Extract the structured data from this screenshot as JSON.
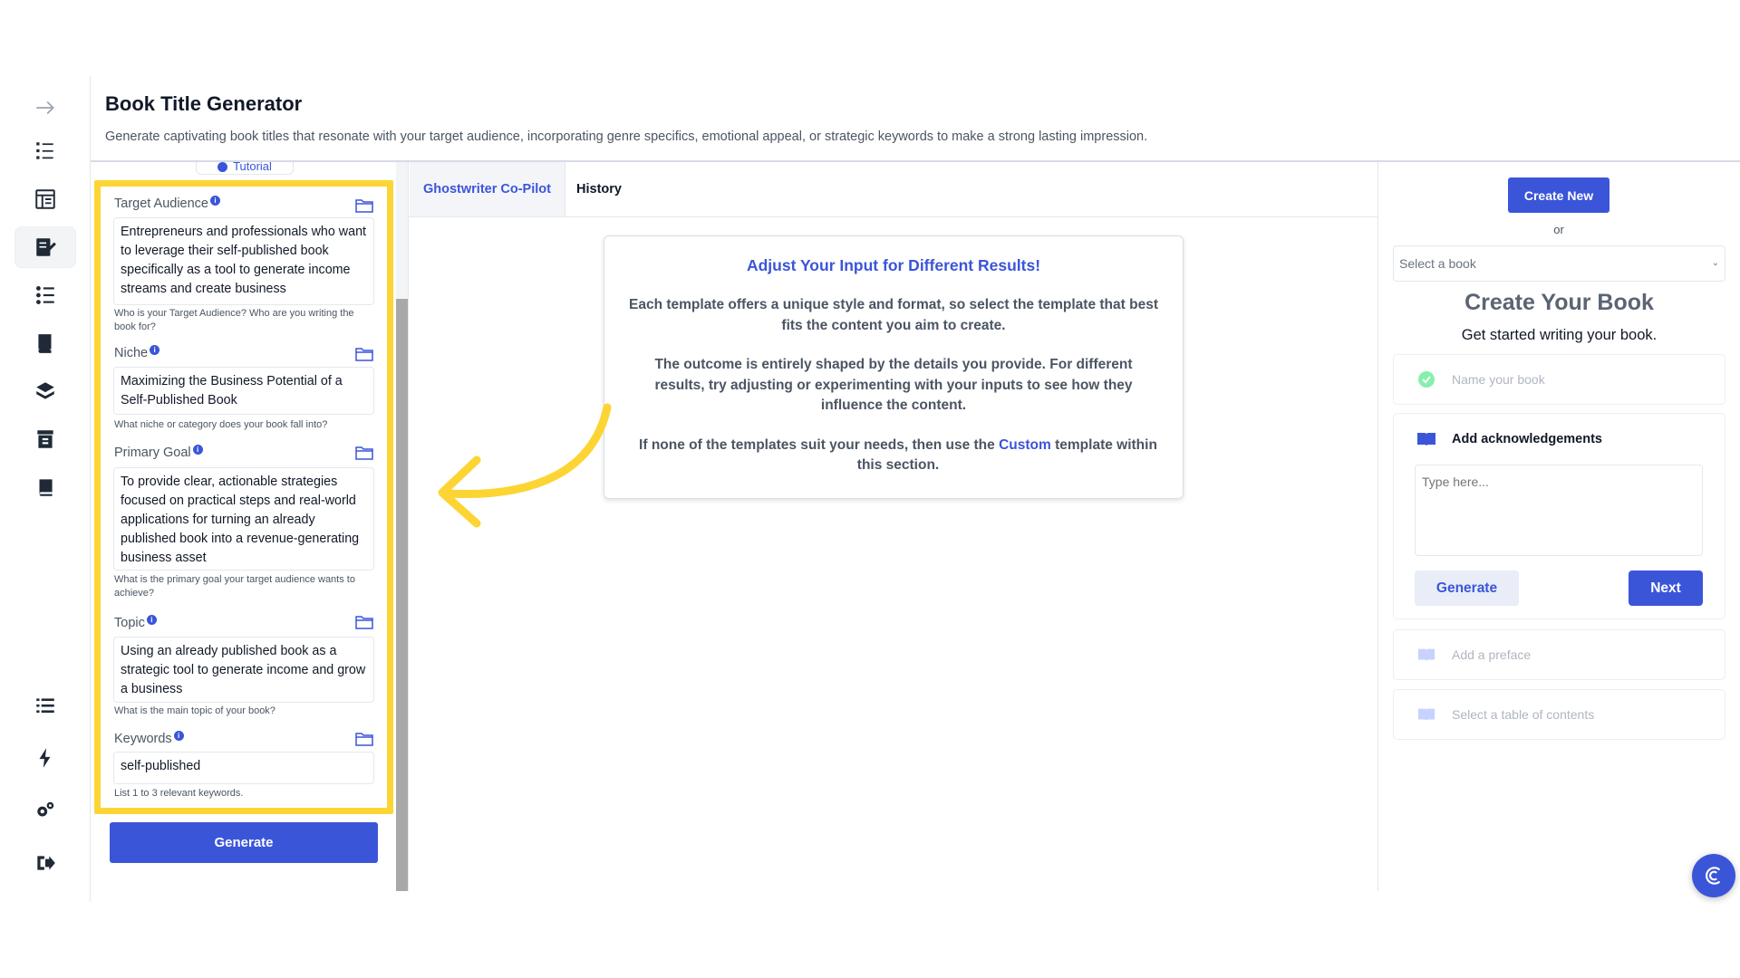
{
  "header": {
    "title": "Book Title Generator",
    "subtitle": "Generate captivating book titles that resonate with your target audience, incorporating genre specifics, emotional appeal, or strategic keywords to make a strong lasting impression."
  },
  "rail": {
    "items": [
      {
        "icon": "arrow-right-icon"
      },
      {
        "icon": "numbered-list-icon"
      },
      {
        "icon": "document-grid-icon"
      },
      {
        "icon": "edit-document-icon",
        "active": true
      },
      {
        "icon": "checklist-icon"
      },
      {
        "icon": "book-stack-icon"
      },
      {
        "icon": "books-icon"
      },
      {
        "icon": "archive-icon"
      },
      {
        "icon": "book-icon"
      },
      {
        "icon": "list-icon"
      },
      {
        "icon": "lightning-icon"
      },
      {
        "icon": "settings-gears-icon"
      },
      {
        "icon": "logout-icon"
      }
    ]
  },
  "form": {
    "tutorial_label": "Tutorial",
    "fields": [
      {
        "label": "Target Audience",
        "value": "Entrepreneurs and professionals who want to leverage their self-published book specifically as a tool to generate income streams and create business",
        "help": "Who is your Target Audience? Who are you writing the book for?"
      },
      {
        "label": "Niche",
        "value": "Maximizing the Business Potential of a Self-Published Book",
        "help": "What niche or category does your book fall into?"
      },
      {
        "label": "Primary Goal",
        "value": "To provide clear, actionable strategies focused on practical steps and real-world applications for turning an already published book into a revenue-generating business asset",
        "help": "What is the primary goal your target audience wants to achieve?"
      },
      {
        "label": "Topic",
        "value": "Using an already published book as a strategic tool to generate income and grow a business",
        "help": "What is the main topic of your book?"
      },
      {
        "label": "Keywords",
        "value": "self-published",
        "help": "List 1 to 3 relevant keywords."
      }
    ],
    "generate_label": "Generate"
  },
  "center": {
    "tabs": [
      {
        "label": "Ghostwriter Co-Pilot",
        "active": true
      },
      {
        "label": "History",
        "active": false
      }
    ],
    "card": {
      "title": "Adjust Your Input for Different Results!",
      "p1": "Each template offers a unique style and format, so select the template that best fits the content you aim to create.",
      "p2": "The outcome is entirely shaped by the details you provide. For different results, try adjusting or experimenting with your inputs to see how they influence the content.",
      "p3_before": "If none of the templates suit your needs, then use the",
      "p3_link": "Custom",
      "p3_after": "template within this section."
    }
  },
  "right": {
    "create_new_label": "Create New",
    "or_label": "or",
    "select_placeholder": "Select a book",
    "title": "Create Your Book",
    "subtitle": "Get started writing your book.",
    "steps": {
      "name_label": "Name your book",
      "ack_label": "Add acknowledgements",
      "ack_placeholder": "Type here...",
      "ack_generate_label": "Generate",
      "ack_next_label": "Next",
      "preface_label": "Add a preface",
      "toc_label": "Select a table of contents"
    }
  },
  "colors": {
    "accent": "#3b55d9",
    "highlight": "#fcd535",
    "check": "#86efac"
  }
}
